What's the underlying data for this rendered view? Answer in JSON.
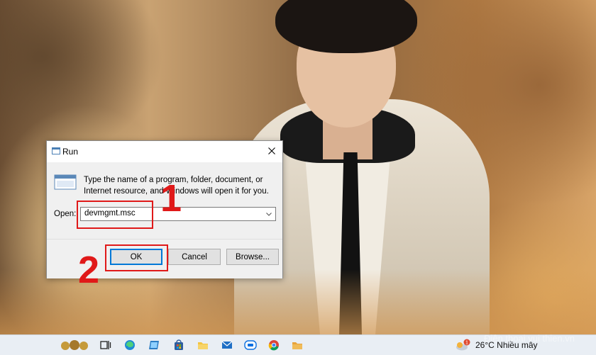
{
  "dialog": {
    "title": "Run",
    "description": "Type the name of a program, folder, document, or Internet resource, and Windows will open it for you.",
    "open_label": "Open:",
    "open_value": "devmgmt.msc",
    "ok_label": "OK",
    "cancel_label": "Cancel",
    "browse_label": "Browse..."
  },
  "annotations": {
    "step1": "1",
    "step2": "2",
    "color": "#e01919"
  },
  "taskbar": {
    "icons": [
      "widgets-icon",
      "task-view-icon",
      "edge-icon",
      "photos-icon",
      "store-icon",
      "explorer-icon",
      "mail-icon",
      "zalo-icon",
      "chrome-icon",
      "folder-icon"
    ],
    "weather": "26°C  Nhiều mây",
    "weather_badge": "1"
  },
  "watermark": "Điện thoại vui thien.vn"
}
